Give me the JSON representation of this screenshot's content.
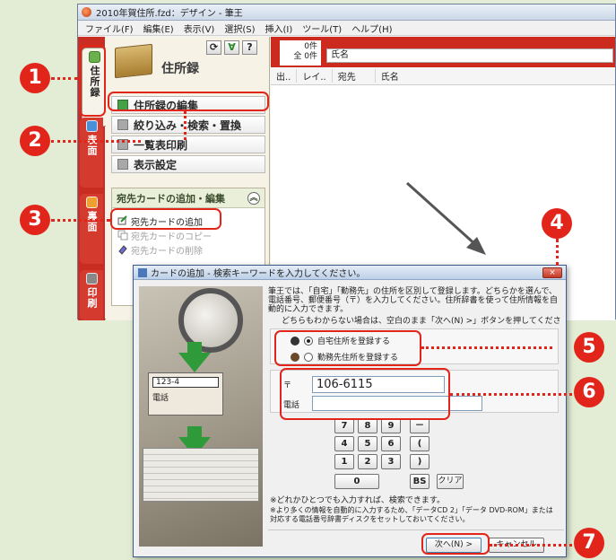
{
  "window": {
    "title": "2010年賀住所.fzd：デザイン - 筆王",
    "menus": [
      "ファイル(F)",
      "編集(E)",
      "表示(V)",
      "選択(S)",
      "挿入(I)",
      "ツール(T)",
      "ヘルプ(H)"
    ]
  },
  "vertical_tabs": {
    "address": "住所録",
    "front": "表面",
    "back": "裏面",
    "print": "印刷"
  },
  "left_panel": {
    "title": "住所録",
    "help_button": "?",
    "menu": {
      "edit": "住所録の編集",
      "filter": "絞り込み・検索・置換",
      "list_print": "一覧表印刷",
      "display": "表示設定"
    },
    "card_group": {
      "title": "宛先カードの追加・編集",
      "add": "宛先カードの追加",
      "copy": "宛先カードのコピー",
      "delete": "宛先カードの削除"
    }
  },
  "right_pane": {
    "count_line1": "0件",
    "count_line2": "全 0件",
    "sort_field": "氏名",
    "columns": [
      "出..",
      "レイ..",
      "宛先",
      "氏名"
    ]
  },
  "dialog": {
    "title": "カードの追加 - 検索キーワードを入力してください。",
    "close": "×",
    "intro": "筆王では、「自宅」「勤務先」の住所を区別して登録します。どちらかを選んで、電話番号、郵便番号（〒）を入力してください。住所辞書を使って住所情報を自動的に入力できます。",
    "hint": "どちらもわからない場合は、空白のまま「次へ(N) >」ボタンを押してください。",
    "radio_home": "自宅住所を登録する",
    "radio_work": "勤務先住所を登録する",
    "postal_label": "〒",
    "postal_value": "106-6115",
    "phone_label": "電話",
    "illustration_postal": "123-4",
    "illustration_phone": "電話",
    "keys": [
      "7",
      "8",
      "9",
      "－",
      "4",
      "5",
      "6",
      "(",
      "1",
      "2",
      "3",
      ")",
      "0",
      "BS",
      "クリア"
    ],
    "note1": "※どれかひとつでも入力すれば、検索できます。",
    "note2": "※より多くの情報を自動的に入力するため、「データCD 2」「データ DVD-ROM」または対応する電話番号辞書ディスクをセットしておいてください。",
    "next": "次へ(N) >",
    "cancel": "キャンセル"
  },
  "callouts": [
    "1",
    "2",
    "3",
    "4",
    "5",
    "6",
    "7"
  ],
  "colors": {
    "accent_red": "#e1251b",
    "tab_red": "#c92d22",
    "bg": "#e3ecd4"
  }
}
